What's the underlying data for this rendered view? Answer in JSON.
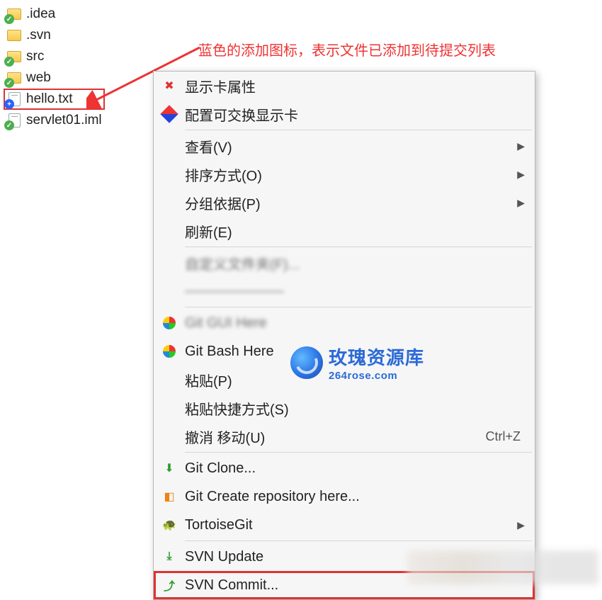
{
  "annotation": {
    "text": "蓝色的添加图标，表示文件已添加到待提交列表"
  },
  "file_list": [
    {
      "name": ".idea",
      "icon": "folder",
      "overlay": "green"
    },
    {
      "name": ".svn",
      "icon": "folder",
      "overlay": null
    },
    {
      "name": "src",
      "icon": "folder",
      "overlay": "green"
    },
    {
      "name": "web",
      "icon": "folder",
      "overlay": "green"
    },
    {
      "name": "hello.txt",
      "icon": "textfile",
      "overlay": "blue",
      "highlight": true
    },
    {
      "name": "servlet01.iml",
      "icon": "textfile",
      "overlay": "green"
    }
  ],
  "context_menu": {
    "items": [
      {
        "label": "显示卡属性",
        "icon": "red-x",
        "submenu": false
      },
      {
        "label": "配置可交换显示卡",
        "icon": "gpu",
        "submenu": false
      },
      "sep",
      {
        "label": "查看(V)",
        "icon": null,
        "submenu": true
      },
      {
        "label": "排序方式(O)",
        "icon": null,
        "submenu": true
      },
      {
        "label": "分组依据(P)",
        "icon": null,
        "submenu": true
      },
      {
        "label": "刷新(E)",
        "icon": null,
        "submenu": false
      },
      "sep",
      {
        "label": "blurred",
        "icon": null,
        "submenu": false,
        "blurred": true
      },
      {
        "label": "blurred",
        "icon": null,
        "submenu": false,
        "blurred": true
      },
      "sep",
      {
        "label": "blurred",
        "icon": "multi",
        "submenu": false,
        "blurred": true
      },
      {
        "label": "Git Bash Here",
        "icon": "multi",
        "submenu": false
      },
      {
        "label": "粘贴(P)",
        "icon": null,
        "submenu": false
      },
      {
        "label": "粘贴快捷方式(S)",
        "icon": null,
        "submenu": false
      },
      {
        "label": "撤消 移动(U)",
        "icon": null,
        "submenu": false,
        "shortcut": "Ctrl+Z"
      },
      "sep",
      {
        "label": "Git Clone...",
        "icon": "git-clone",
        "submenu": false
      },
      {
        "label": "Git Create repository here...",
        "icon": "git-create",
        "submenu": false
      },
      {
        "label": "TortoiseGit",
        "icon": "turtle",
        "submenu": true
      },
      "sep",
      {
        "label": "SVN Update",
        "icon": "svn-up",
        "submenu": false
      },
      {
        "label": "SVN Commit...",
        "icon": "svn-commit",
        "submenu": false,
        "highlight": true
      }
    ]
  },
  "watermark": {
    "title": "玫瑰资源库",
    "url": "264rose.com"
  }
}
